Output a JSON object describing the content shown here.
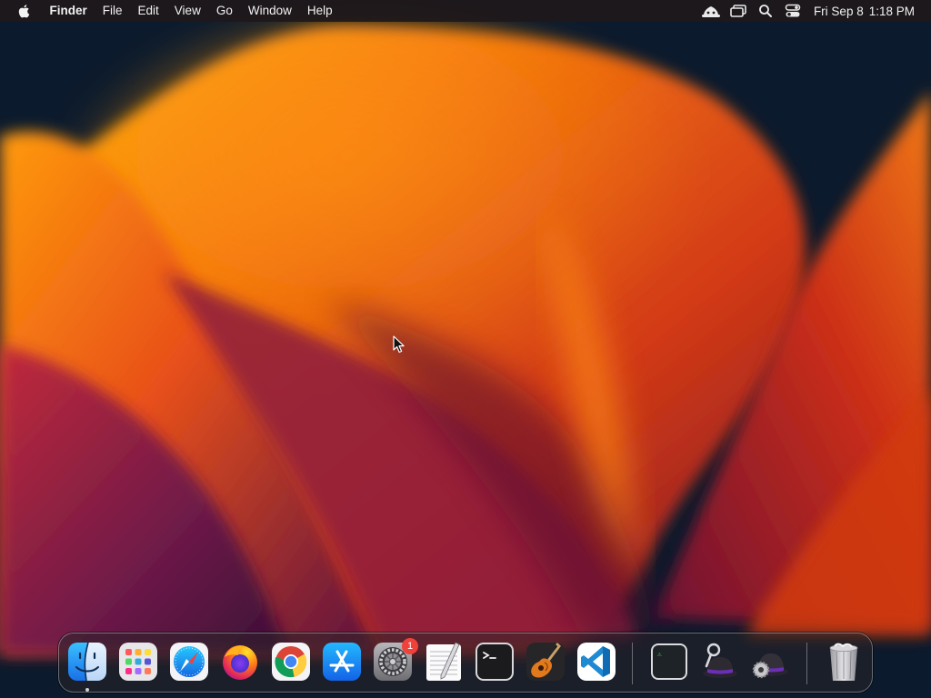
{
  "menubar": {
    "apple_icon": "apple-logo-icon",
    "app_name": "Finder",
    "menus": [
      "File",
      "Edit",
      "View",
      "Go",
      "Window",
      "Help"
    ],
    "status_icons": [
      "user-profile-icon",
      "screen-mirroring-icon",
      "spotlight-search-icon",
      "control-center-icon"
    ],
    "date": "Fri Sep 8",
    "time": "1:18 PM"
  },
  "dock": {
    "apps": [
      {
        "name": "Finder",
        "icon": "finder-icon",
        "running": true
      },
      {
        "name": "Launchpad",
        "icon": "launchpad-icon"
      },
      {
        "name": "Safari",
        "icon": "safari-icon"
      },
      {
        "name": "Firefox",
        "icon": "firefox-icon"
      },
      {
        "name": "Chrome",
        "icon": "chrome-icon"
      },
      {
        "name": "App Store",
        "icon": "app-store-icon"
      },
      {
        "name": "System Settings",
        "icon": "system-settings-icon",
        "badge": "1"
      },
      {
        "name": "TextEdit",
        "icon": "textedit-icon"
      },
      {
        "name": "Terminal",
        "icon": "terminal-icon"
      },
      {
        "name": "GarageBand",
        "icon": "garageband-icon"
      },
      {
        "name": "Visual Studio Code",
        "icon": "vscode-icon"
      }
    ],
    "extras": [
      {
        "name": "Console",
        "icon": "console-icon"
      },
      {
        "name": "Alfred",
        "icon": "alfred-icon"
      },
      {
        "name": "Alfred Preferences",
        "icon": "alfred-preferences-icon"
      }
    ],
    "trash": {
      "name": "Trash",
      "icon": "trash-icon"
    }
  },
  "colors": {
    "menubar_bg": "#1e181a",
    "badge": "#f0413a",
    "wallpaper_primary": "#e8501a",
    "wallpaper_dark": "#0b1a2c"
  }
}
